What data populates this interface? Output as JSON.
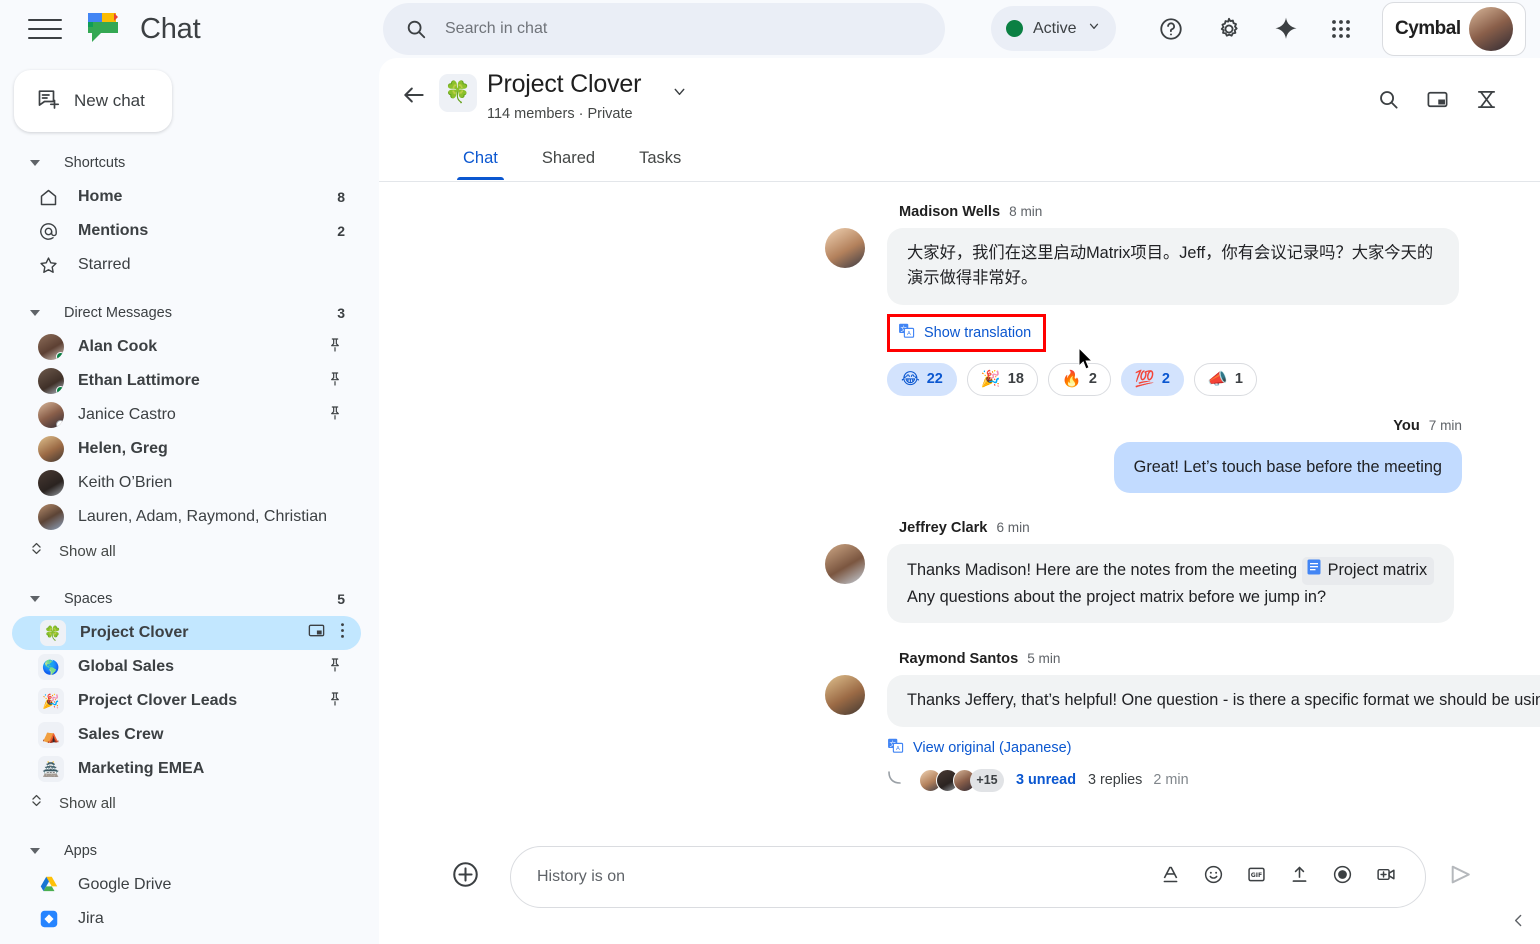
{
  "app": {
    "name": "Chat",
    "logo_icon": "google-chat-logo-icon",
    "menu_icon": "hamburger-menu-icon"
  },
  "search": {
    "placeholder": "Search in chat",
    "value": "",
    "icon": "search-icon"
  },
  "status": {
    "label": "Active",
    "color": "#0b8043",
    "caret_icon": "chevron-down-icon"
  },
  "topbar_icons": [
    {
      "name": "help-icon",
      "glyph": "?"
    },
    {
      "name": "settings-gear-icon",
      "glyph": "gear"
    },
    {
      "name": "gemini-sparkle-icon",
      "glyph": "sparkle"
    },
    {
      "name": "google-apps-grid-icon",
      "glyph": "grid"
    }
  ],
  "brand": {
    "name": "Cymbal",
    "avatar": "user-avatar"
  },
  "sidebar": {
    "new_chat": {
      "label": "New chat",
      "icon": "new-chat-icon"
    },
    "sections": [
      {
        "key": "shortcuts",
        "label": "Shortcuts",
        "count": "",
        "items": [
          {
            "label": "Home",
            "icon": "home-icon",
            "count": "8",
            "bold": true
          },
          {
            "label": "Mentions",
            "icon": "at-mention-icon",
            "count": "2",
            "bold": true
          },
          {
            "label": "Starred",
            "icon": "star-icon",
            "count": "",
            "bold": false
          }
        ]
      },
      {
        "key": "direct_messages",
        "label": "Direct Messages",
        "count": "3",
        "items": [
          {
            "label": "Alan Cook",
            "avatar": "f1",
            "presence": "on",
            "pinned": true,
            "bold": true
          },
          {
            "label": "Ethan Lattimore",
            "avatar": "f2",
            "presence": "on",
            "pinned": true,
            "bold": true
          },
          {
            "label": "Janice Castro",
            "avatar": "f3",
            "presence": "off",
            "pinned": true,
            "bold": false
          },
          {
            "label": "Helen, Greg",
            "avatar": "f4",
            "presence": "",
            "pinned": false,
            "bold": true
          },
          {
            "label": "Keith O’Brien",
            "avatar": "f5",
            "presence": "",
            "pinned": false,
            "bold": false
          },
          {
            "label": "Lauren, Adam, Raymond, Christian",
            "avatar": "f6",
            "presence": "",
            "pinned": false,
            "bold": false
          }
        ],
        "show_all": "Show all"
      },
      {
        "key": "spaces",
        "label": "Spaces",
        "count": "5",
        "items": [
          {
            "label": "Project Clover",
            "emoji": "🍀",
            "active": true,
            "bold": true,
            "trailing_icons": [
              "open-in-panel-icon",
              "more-options-icon"
            ]
          },
          {
            "label": "Global Sales",
            "emoji": "🌎",
            "pinned": true,
            "bold": true
          },
          {
            "label": "Project Clover Leads",
            "emoji": "🎉",
            "pinned": true,
            "bold": true
          },
          {
            "label": "Sales Crew",
            "emoji": "⛺",
            "pinned": false,
            "bold": true
          },
          {
            "label": "Marketing EMEA",
            "emoji": "🏯",
            "pinned": false,
            "bold": true
          }
        ],
        "show_all": "Show all"
      },
      {
        "key": "apps",
        "label": "Apps",
        "count": "",
        "items": [
          {
            "label": "Google Drive",
            "icon": "google-drive-icon",
            "bold": false
          },
          {
            "label": "Jira",
            "icon": "jira-icon",
            "bold": false
          }
        ]
      }
    ]
  },
  "room": {
    "title": "Project Clover",
    "emoji": "🍀",
    "subtitle": "114 members · Private",
    "back_icon": "back-arrow-icon",
    "title_caret_icon": "chevron-down-icon",
    "tabs": [
      {
        "label": "Chat",
        "selected": true
      },
      {
        "label": "Shared",
        "selected": false
      },
      {
        "label": "Tasks",
        "selected": false
      }
    ],
    "header_icons": [
      {
        "name": "search-in-space-icon"
      },
      {
        "name": "open-in-split-view-icon"
      },
      {
        "name": "video-huddle-icon"
      }
    ]
  },
  "messages": [
    {
      "id": "m1",
      "author": "Madison Wells",
      "time": "8 min",
      "avatar": "f7",
      "side": "left",
      "text": "大家好，我们在这里启动Matrix项目。Jeff，你有会议记录吗？大家今天的演示做得非常好。",
      "translation_link": "Show translation",
      "translation_highlighted": true,
      "reactions": [
        {
          "emoji": "😂",
          "count": "22",
          "selected": true
        },
        {
          "emoji": "🎉",
          "count": "18",
          "selected": false
        },
        {
          "emoji": "🔥",
          "count": "2",
          "selected": false
        },
        {
          "emoji": "💯",
          "count": "2",
          "selected": true
        },
        {
          "emoji": "📣",
          "count": "1",
          "selected": false
        }
      ]
    },
    {
      "id": "m2",
      "author": "You",
      "time": "7 min",
      "side": "right",
      "text": "Great! Let’s touch base before the meeting"
    },
    {
      "id": "m3",
      "author": "Jeffrey Clark",
      "time": "6 min",
      "avatar": "f8",
      "side": "left",
      "text_before_chip": "Thanks Madison!  Here are the notes from the meeting ",
      "chip": {
        "label": "Project matrix",
        "icon": "google-docs-icon"
      },
      "text_line2": "Any questions about the project matrix before we jump in?"
    },
    {
      "id": "m4",
      "author": "Raymond Santos",
      "time": "5 min",
      "avatar": "f4",
      "side": "left",
      "text": "Thanks Jeffery, that’s helpful!  One question -  is there a specific format we should be using for filling out the matrix?",
      "translation_link": "View original (Japanese)",
      "thread": {
        "avatars": [
          "f7",
          "f5",
          "f3"
        ],
        "more": "+15",
        "unread": "3 unread",
        "replies": "3 replies",
        "time": "2 min"
      }
    }
  ],
  "composer": {
    "add_icon": "add-attachment-icon",
    "placeholder": "History is on",
    "value": "",
    "tools": [
      {
        "name": "text-format-icon"
      },
      {
        "name": "emoji-icon"
      },
      {
        "name": "gif-icon"
      },
      {
        "name": "upload-file-icon"
      },
      {
        "name": "record-icon"
      },
      {
        "name": "video-message-icon"
      }
    ],
    "send_icon": "send-icon"
  },
  "collapse": {
    "icon": "chevron-left-icon"
  }
}
